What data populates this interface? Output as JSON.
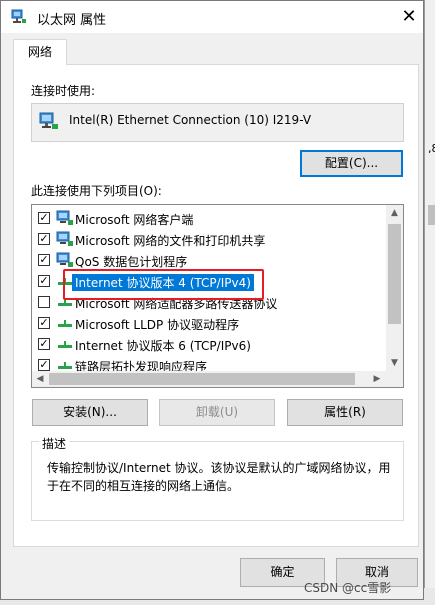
{
  "window": {
    "title": "以太网 属性",
    "close_glyph": "✕"
  },
  "tab": {
    "label": "网络"
  },
  "connect_using": {
    "label": "连接时使用:",
    "adapter": "Intel(R) Ethernet Connection (10) I219-V",
    "configure_button": "配置(C)..."
  },
  "items_label": "此连接使用下列项目(O):",
  "items": [
    {
      "label": "Microsoft 网络客户端",
      "checked": true,
      "icon": "network-client-icon"
    },
    {
      "label": "Microsoft 网络的文件和打印机共享",
      "checked": true,
      "icon": "file-printer-sharing-icon"
    },
    {
      "label": "QoS 数据包计划程序",
      "checked": true,
      "icon": "qos-scheduler-icon"
    },
    {
      "label": "Internet 协议版本 4 (TCP/IPv4)",
      "checked": true,
      "icon": "protocol-icon",
      "selected": true
    },
    {
      "label": "Microsoft 网络适配器多路传送器协议",
      "checked": false,
      "icon": "protocol-icon"
    },
    {
      "label": "Microsoft LLDP 协议驱动程序",
      "checked": true,
      "icon": "protocol-icon"
    },
    {
      "label": "Internet 协议版本 6 (TCP/IPv6)",
      "checked": true,
      "icon": "protocol-icon"
    },
    {
      "label": "链路层拓扑发现响应程序",
      "checked": true,
      "icon": "protocol-icon"
    }
  ],
  "buttons": {
    "install": "安装(N)...",
    "uninstall": "卸载(U)",
    "properties": "属性(R)",
    "ok": "确定",
    "cancel": "取消"
  },
  "description": {
    "title": "描述",
    "text": "传输控制协议/Internet 协议。该协议是默认的广域网络协议，用于在不同的相互连接的网络上通信。"
  },
  "watermark": "CSDN @cc雪影",
  "background_fragment": ",8",
  "colors": {
    "selection": "#0078d7",
    "highlight_frame": "#e51d23",
    "dialog_bg": "#f0f0f0"
  }
}
